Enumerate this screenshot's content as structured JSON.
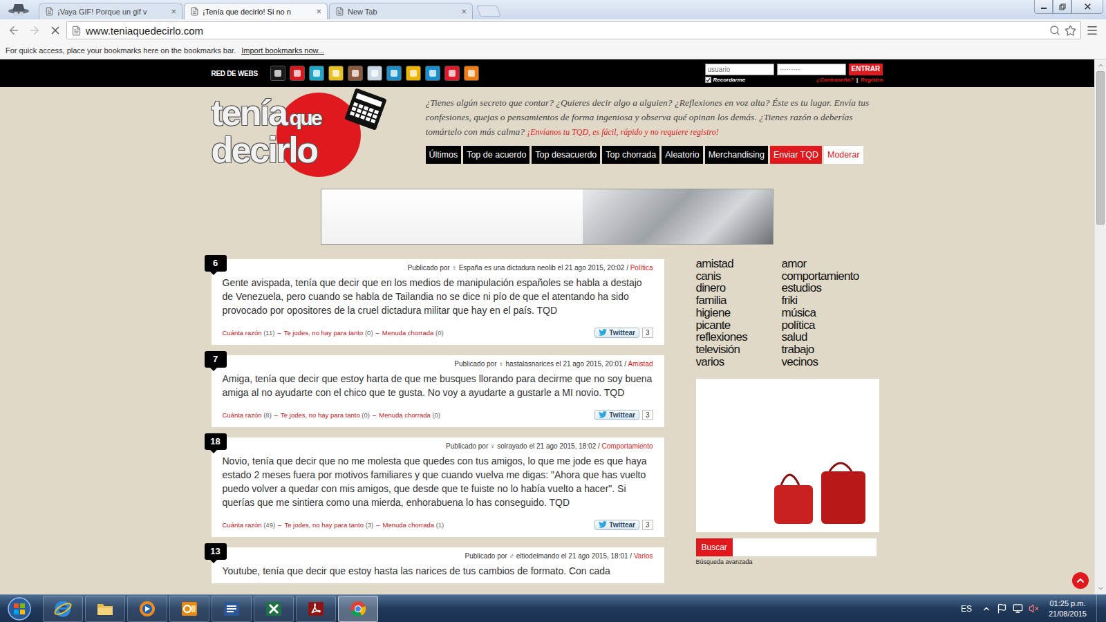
{
  "browser": {
    "tabs": [
      {
        "label": "¡Vaya GIF! Porque un gif v",
        "selected": false,
        "close": "×"
      },
      {
        "label": "¡Tenía que decirlo! Si no n",
        "selected": true,
        "close": "×"
      },
      {
        "label": "New Tab",
        "selected": false,
        "close": "×"
      }
    ],
    "url": "www.teniaquedecirlo.com",
    "loading": true,
    "bookmarks_bar": {
      "hint": "For quick access, place your bookmarks here on the bookmarks bar.",
      "link": "Import bookmarks now..."
    },
    "scrollbar": {
      "level": 0.3
    }
  },
  "site": {
    "network_label": "RED DE WEBS",
    "network": [
      {
        "color": "#1a1a1a"
      },
      {
        "color": "#d6191f"
      },
      {
        "color": "#20a6c9"
      },
      {
        "color": "#e8c020"
      },
      {
        "color": "#8b5a3c"
      },
      {
        "color": "#c9d6e4"
      },
      {
        "color": "#1e8ec8"
      },
      {
        "color": "#f0b400"
      },
      {
        "color": "#1a8fd0"
      },
      {
        "color": "#e0192a"
      },
      {
        "color": "#f07c14"
      }
    ],
    "login": {
      "user_placeholder": "usuario",
      "password_mask": "·········",
      "submit": "ENTRAR",
      "remember": {
        "label": "Recordarme",
        "checked": true
      },
      "forgot": "¿Contraseña?",
      "separator": "|",
      "register": "Registro"
    },
    "logo": {
      "words": [
        "tenía",
        "que",
        "decirlo"
      ]
    },
    "intro": "¿Tienes algún secreto que contar? ¿Quieres decir algo a alguien? ¿Reflexiones en voz alta? Éste es tu lugar. Envía tus confesiones, quejas o pensamientos de forma ingeniosa y observa qué opinan los demás. ¿Tienes razón o deberías tomártelo con más calma?",
    "intro_cta": "¡Envíanos tu TQD, es fácil, rápido y no requiere registro!",
    "nav": [
      {
        "label": "Últimos",
        "kind": "default"
      },
      {
        "label": "Top de acuerdo",
        "kind": "default"
      },
      {
        "label": "Top desacuerdo",
        "kind": "default"
      },
      {
        "label": "Top chorrada",
        "kind": "default"
      },
      {
        "label": "Aleatorio",
        "kind": "default"
      },
      {
        "label": "Merchandising",
        "kind": "default"
      },
      {
        "label": "Enviar TQD",
        "kind": "primary"
      },
      {
        "label": "Moderar",
        "kind": "light"
      }
    ],
    "post_meta": {
      "published_by": "Publicado por",
      "on": "el",
      "category_separator": "/",
      "vote_labels": [
        "Cuánta razón",
        "Te jodes, no hay para tanto",
        "Menuda chorrada"
      ],
      "vote_separator": "–",
      "tweet": "Twittear"
    },
    "posts": [
      {
        "number": "6",
        "gender": "♀",
        "author": "España es una dictadura neolib",
        "date": "21 ago 2015, 20:02",
        "category": "Política",
        "text": "Gente avispada, tenía que decir que en los medios de manipulación españoles se habla a destajo de Venezuela, pero cuando se habla de Tailandia no se dice ni pío de que el atentando ha sido provocado por opositores de la cruel dictadura militar que hay en el país. TQD",
        "votes": [
          "(11)",
          "(0)",
          "(0)"
        ],
        "tweets": "3"
      },
      {
        "number": "7",
        "gender": "♀",
        "author": "hastalasnarices",
        "date": "21 ago 2015, 20:01",
        "category": "Amistad",
        "text": "Amiga, tenía que decir que estoy harta de que me busques llorando para decirme que no soy buena amiga al no ayudarte con el chico que te gusta. No voy a ayudarte a gustarle a MI novio. TQD",
        "votes": [
          "(8)",
          "(0)",
          "(0)"
        ],
        "tweets": "3"
      },
      {
        "number": "18",
        "gender": "♀",
        "author": "solrayado",
        "date": "21 ago 2015, 18:02",
        "category": "Comportamiento",
        "text": "Novio, tenía que decir que no me molesta que quedes con tus amigos, lo que me jode es que haya estado 2 meses fuera por motivos familiares y que cuando vuelva me digas: \"Ahora que has vuelto puedo volver a quedar con mis amigos, que desde que te fuiste no lo había vuelto a hacer\". Si querías que me sintiera como una mierda, enhorabuena lo has conseguido. TQD",
        "votes": [
          "(49)",
          "(3)",
          "(1)"
        ],
        "tweets": "3"
      },
      {
        "number": "13",
        "gender": "♂",
        "author": "eltiodelmando",
        "date": "21 ago 2015, 18:01",
        "category": "Varios",
        "text": "Youtube, tenía que decir que estoy hasta las narices de tus cambios de formato. Con cada"
      }
    ],
    "tag_columns": [
      [
        "amistad",
        "canis",
        "dinero",
        "familia",
        "higiene",
        "picante",
        "reflexiones",
        "televisión",
        "varios"
      ],
      [
        "amor",
        "comportamiento",
        "estudios",
        "friki",
        "música",
        "política",
        "salud",
        "trabajo",
        "vecinos"
      ]
    ],
    "search": {
      "button": "Buscar",
      "advanced": "Búsqueda avanzada"
    }
  },
  "taskbar": {
    "apps": [
      {
        "kind": "ie",
        "selected": false
      },
      {
        "kind": "folder",
        "selected": false
      },
      {
        "kind": "media",
        "selected": false
      },
      {
        "kind": "outlook",
        "selected": false
      },
      {
        "kind": "word",
        "selected": false
      },
      {
        "kind": "excel",
        "selected": false
      },
      {
        "kind": "acrobat",
        "selected": false
      },
      {
        "kind": "chrome",
        "selected": true
      }
    ],
    "language": "ES",
    "time": "01:25 p.m.",
    "date": "21/08/2015"
  }
}
